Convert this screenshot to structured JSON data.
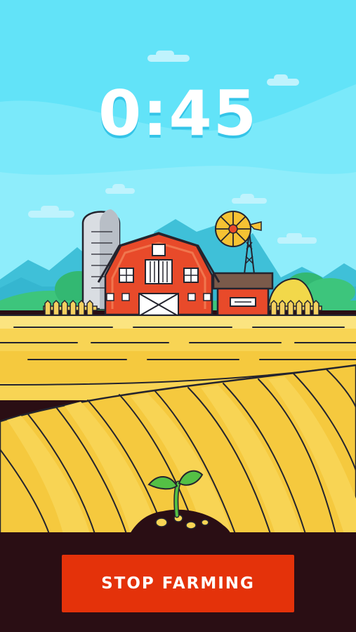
{
  "timer": {
    "display": "0:45"
  },
  "actions": {
    "stop_label": "STOP FARMING"
  },
  "colors": {
    "sky": "#62e3f8",
    "barn_red": "#e84a2a",
    "field_yellow": "#f8d454",
    "soil": "#2a0e14",
    "button_red": "#e4320a",
    "sprout_green": "#54c045"
  },
  "icons": {
    "barn": "barn-icon",
    "silo": "silo-icon",
    "windmill": "windmill-icon",
    "sprout": "sprout-icon"
  }
}
